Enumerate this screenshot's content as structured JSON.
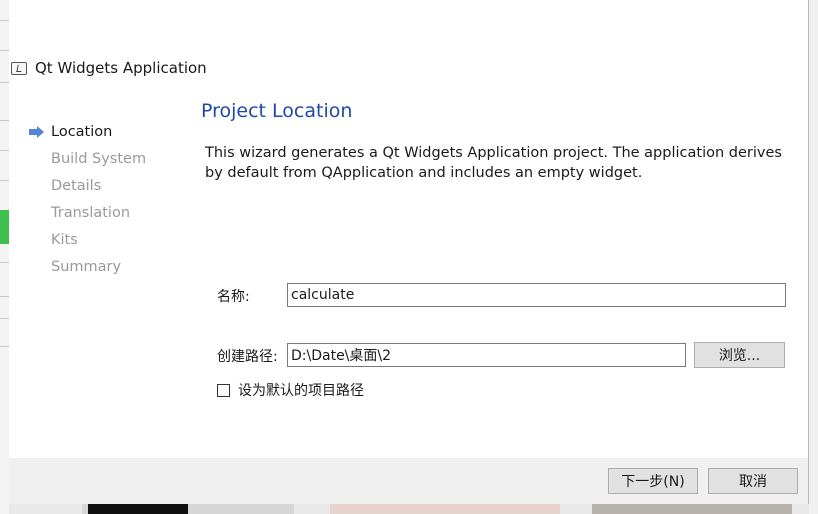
{
  "dialog": {
    "title": "Qt Widgets Application",
    "icon": "qt-widget-app-icon"
  },
  "steps": [
    {
      "label": "Location",
      "active": true
    },
    {
      "label": "Build System",
      "active": false
    },
    {
      "label": "Details",
      "active": false
    },
    {
      "label": "Translation",
      "active": false
    },
    {
      "label": "Kits",
      "active": false
    },
    {
      "label": "Summary",
      "active": false
    }
  ],
  "page": {
    "heading": "Project Location",
    "description": "This wizard generates a Qt Widgets Application project. The application derives by default from QApplication and includes an empty widget."
  },
  "form": {
    "name_label": "名称:",
    "name_value": "calculate",
    "path_label": "创建路径:",
    "path_value": "D:\\Date\\桌面\\2",
    "browse_label": "浏览...",
    "default_path_label": "设为默认的项目路径",
    "default_path_checked": false
  },
  "footer": {
    "next_label": "下一步(N)",
    "cancel_label": "取消"
  },
  "colors": {
    "heading": "#1f4aa6",
    "active_arrow": "#4f86d9",
    "inactive_step": "#9a9a9a"
  }
}
